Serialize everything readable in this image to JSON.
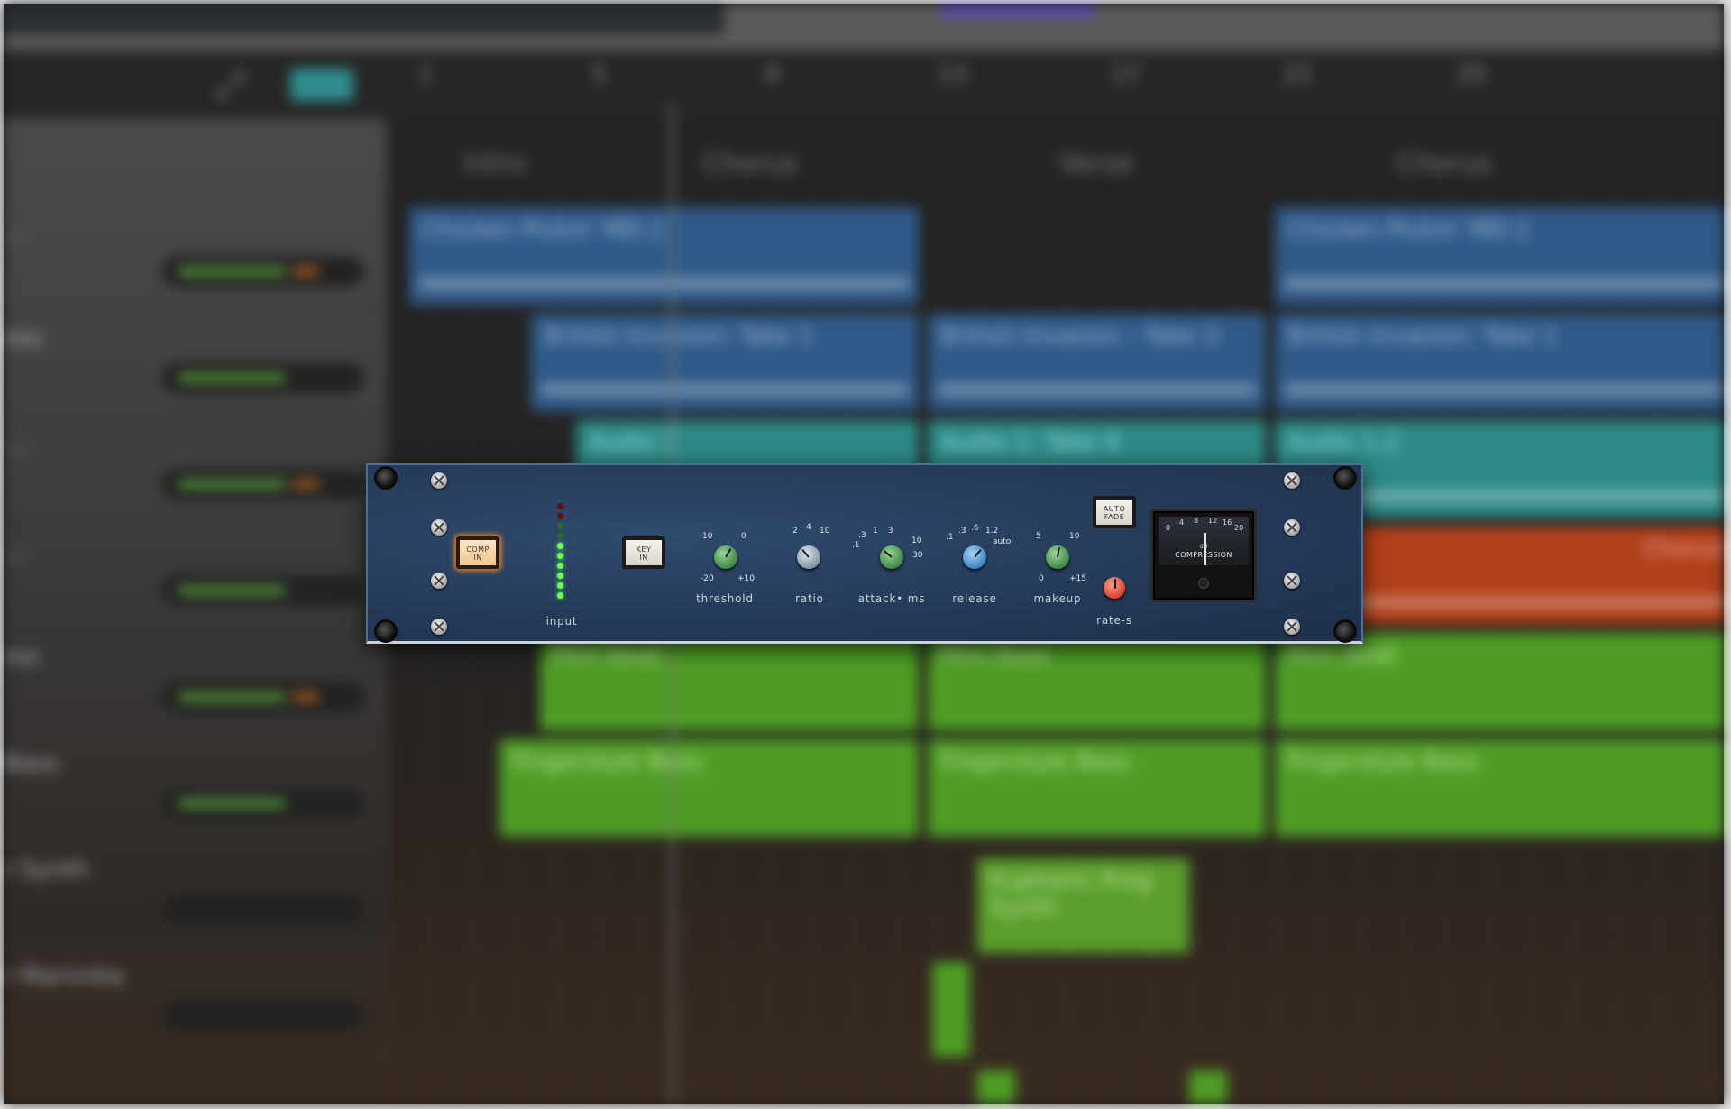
{
  "daw": {
    "bar_numbers": [
      "1",
      "5",
      "9",
      "13",
      "17",
      "21",
      "25"
    ],
    "sections": [
      "Intro",
      "Chorus",
      "Verse",
      "Chorus"
    ],
    "tracks": [
      {
        "name": "..."
      },
      {
        "name": "ess"
      },
      {
        "name": "..."
      },
      {
        "name": "..."
      },
      {
        "name": "ms"
      },
      {
        "name": "Bass"
      },
      {
        "name": "r Synth"
      },
      {
        "name": "r Marimba"
      }
    ],
    "regions": {
      "r1a": "Chicken Pickin' MD.1",
      "r1b": "Chicken Pickin' MD.1",
      "r2a": "British Invasion: Take 1",
      "r2b": "British Invasion - Take 3",
      "r2c": "British Invasion: Take 1",
      "r3a": "Audio 1",
      "r3b": "Audio 1: Take 4",
      "r3c": "Audio 1.2",
      "r4a": "Chorus",
      "r5a": "Mini Beat",
      "r5b": "Mini Beat",
      "r5c": "Mini Beat",
      "r6a": "Fingerstyle Bass",
      "r6b": "Fingerstyle Bass",
      "r6c": "Fingerstyle Bass",
      "r7a": "Euphoric Prog Synth"
    }
  },
  "plugin": {
    "comp_in": [
      "COMP",
      "IN"
    ],
    "key_in": [
      "KEY",
      "IN"
    ],
    "auto_fade": [
      "AUTO",
      "FADE"
    ],
    "input_label": "input",
    "threshold": {
      "label": "threshold",
      "scale": [
        "10",
        "0",
        "-20",
        "+10"
      ]
    },
    "ratio": {
      "label": "ratio",
      "scale": [
        "2",
        "4",
        "10"
      ]
    },
    "attack": {
      "label": "attack• ms",
      "scale": [
        "1",
        "3",
        ".3",
        "10",
        "30",
        ".1"
      ]
    },
    "release": {
      "label": "release",
      "scale": [
        ".3",
        ".6",
        "1.2",
        "auto",
        ".1"
      ]
    },
    "makeup": {
      "label": "makeup",
      "scale": [
        "5",
        "10",
        "0",
        "+15"
      ]
    },
    "rate": {
      "label": "rate-s"
    },
    "meter": {
      "label": "COMPRESSION",
      "unit": "dB",
      "marks": [
        "0",
        "4",
        "8",
        "12",
        "16",
        "20"
      ]
    }
  },
  "colors": {
    "panel": "#243a58",
    "comp_led": "#f3c48c",
    "led_green": "#6cff55"
  }
}
